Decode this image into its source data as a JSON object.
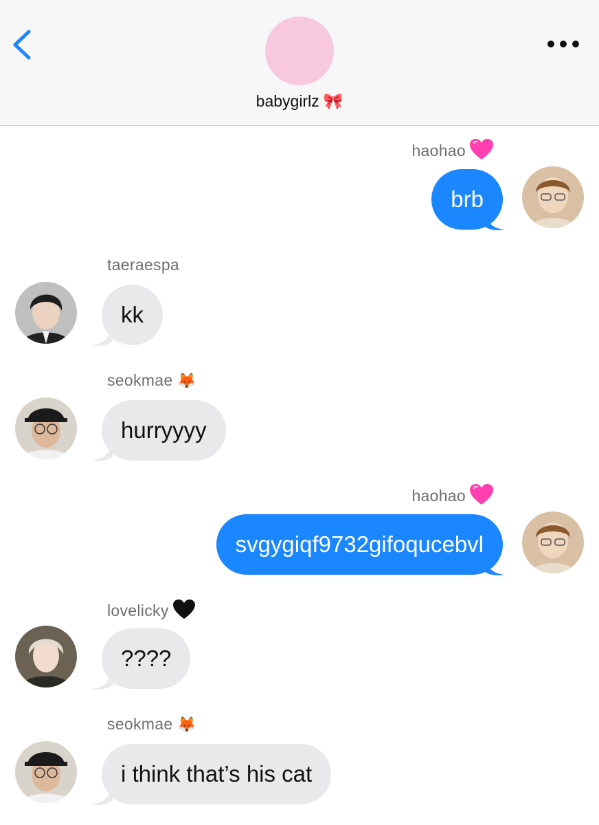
{
  "header": {
    "group_name": "babygirlz",
    "group_emoji": "🎀",
    "avatar_color": "#f8c8de",
    "back_icon": "chevron-left-icon",
    "more_icon": "ellipsis-icon"
  },
  "colors": {
    "outgoing_bubble": "#1a86ff",
    "incoming_bubble": "#e9e9eb",
    "back_chevron": "#1a86ff"
  },
  "messages": [
    {
      "sender": "haohao",
      "sender_emoji": "💗",
      "text": "brb",
      "direction": "outgoing"
    },
    {
      "sender": "taeraespa",
      "sender_emoji": "",
      "text": "kk",
      "direction": "incoming"
    },
    {
      "sender": "seokmae",
      "sender_emoji": "🦊",
      "text": "hurryyyy",
      "direction": "incoming"
    },
    {
      "sender": "haohao",
      "sender_emoji": "💗",
      "text": "svgygiqf9732gifoqucebvl",
      "direction": "outgoing"
    },
    {
      "sender": "lovelicky",
      "sender_emoji": "🖤",
      "text": "????",
      "direction": "incoming"
    },
    {
      "sender": "seokmae",
      "sender_emoji": "🦊",
      "text": "i think that’s his cat",
      "direction": "incoming"
    }
  ]
}
